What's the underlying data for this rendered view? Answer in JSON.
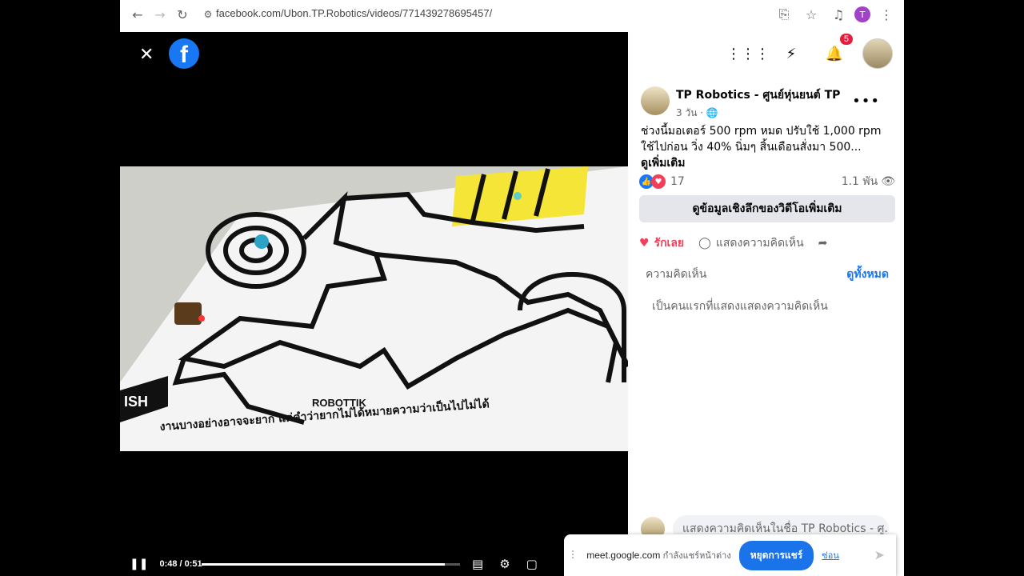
{
  "browser": {
    "url_host": "facebook.com",
    "url_path": "/Ubon.TP.Robotics/videos/771439278695457/",
    "profile_initial": "T"
  },
  "video": {
    "time": "0:48 / 0:51",
    "progress": 0.94,
    "poster_texts": {
      "brand": "ROBOTTIK",
      "finish": "ISH",
      "slogan": "งานบางอย่างอาจจะยาก แต่คำว่ายากไม่ได้หมายความว่าเป็นไปไม่ได้"
    }
  },
  "header": {
    "notifications_count": "5"
  },
  "post": {
    "page_name": "TP Robotics - ศูนย์หุ่นยนต์ TP",
    "meta": "3 วัน ·",
    "text": "ช่วงนี้มอเตอร์ 500 rpm หมด ปรับใช้ 1,000 rpm ใช้ไปก่อน วิ่ง 40% นิ่มๆ สิ้นเดือนสั่งมา 500...",
    "see_more": "ดูเพิ่มเติม",
    "reactions_count": "17",
    "views": "1.1 พัน",
    "insights_label": "ดูข้อมูลเชิงลึกของวิดีโอเพิ่มเติม",
    "love_label": "รักเลย",
    "comment_label": "แสดงความคิดเห็น",
    "comments_title": "ความคิดเห็น",
    "view_all": "ดูทั้งหมด",
    "first_comment_prompt": "เป็นคนแรกที่แสดงแสดงความคิดเห็น",
    "comment_placeholder": "แสดงความคิดเห็นในชื่อ TP Robotics - ศู..."
  },
  "meet": {
    "host": "meet.google.com",
    "sharing_text": "กำลังแชร์หน้าต่าง",
    "stop_label": "หยุดการแชร์",
    "hide_label": "ซ่อน"
  }
}
